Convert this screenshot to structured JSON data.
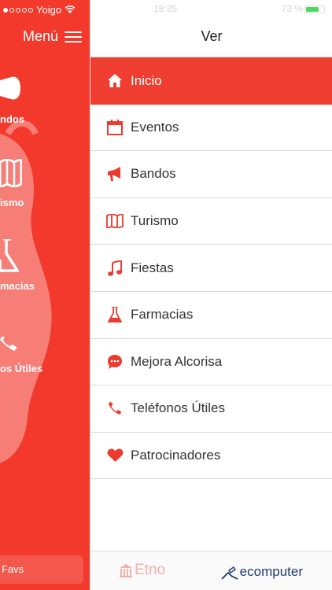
{
  "status": {
    "carrier": "Yoigo",
    "time": "18:35",
    "battery_pct": "73 %",
    "battery_level": 0.73,
    "colors": {
      "battery": "#4cd964"
    }
  },
  "left_panel": {
    "menu_label": "Menú",
    "items": [
      {
        "label": "ndos",
        "icon": "megaphone-icon"
      },
      {
        "label": "ismo",
        "icon": "map-icon"
      },
      {
        "label": "macias",
        "icon": "flask-icon"
      },
      {
        "label": "os Útiles",
        "icon": "phone-icon"
      }
    ],
    "favs_label": "Favs",
    "colors": {
      "background": "#f2392c"
    }
  },
  "right_panel": {
    "title": "Ver",
    "items": [
      {
        "label": "Inicio",
        "icon": "home-icon",
        "active": true
      },
      {
        "label": "Eventos",
        "icon": "calendar-icon"
      },
      {
        "label": "Bandos",
        "icon": "megaphone-icon"
      },
      {
        "label": "Turismo",
        "icon": "map-icon"
      },
      {
        "label": "Fiestas",
        "icon": "music-note-icon"
      },
      {
        "label": "Farmacias",
        "icon": "flask-icon"
      },
      {
        "label": "Mejora Alcorisa",
        "icon": "chat-bubble-icon"
      },
      {
        "label": "Teléfonos Útiles",
        "icon": "phone-icon"
      },
      {
        "label": "Patrocinadores",
        "icon": "heart-icon"
      }
    ],
    "colors": {
      "accent": "#ef3e31",
      "icon": "#ec3b2e"
    }
  },
  "footer": {
    "left_logo": "Etno",
    "right_logo": "ecomputer"
  }
}
